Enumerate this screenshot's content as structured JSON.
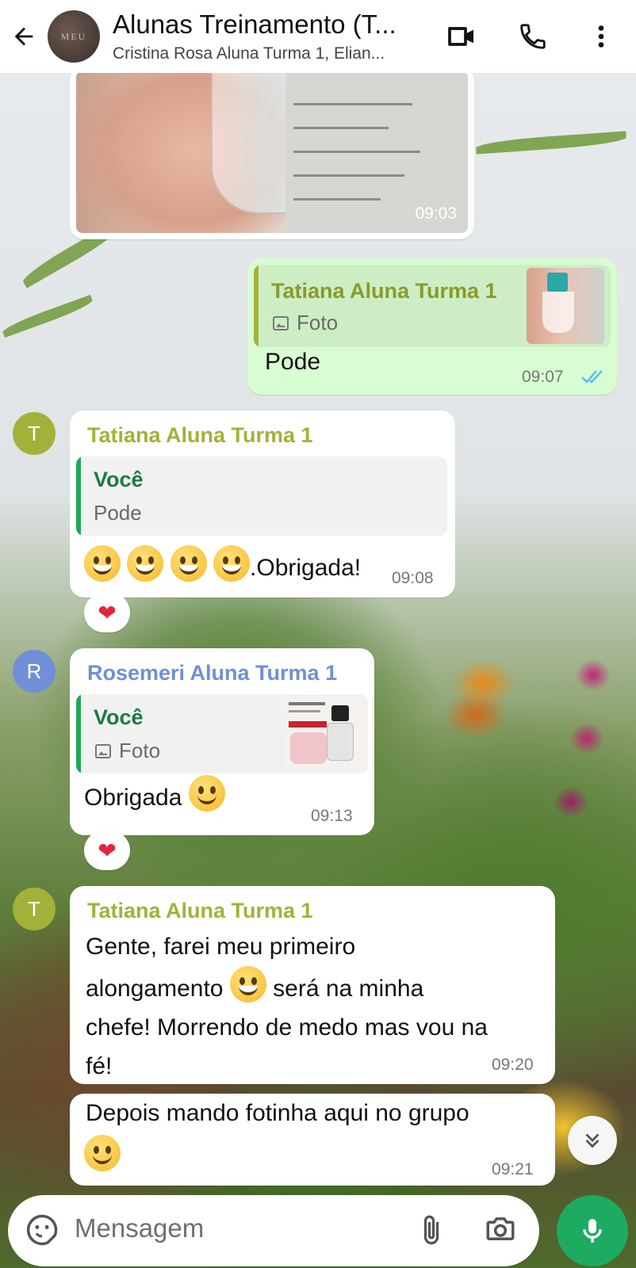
{
  "header": {
    "title": "Alunas Treinamento (T...",
    "subtitle": "Cristina Rosa Aluna Turma 1, Elian...",
    "avatar_text": "MEU"
  },
  "messages": {
    "photo": {
      "time": "09:03"
    },
    "m1": {
      "quote_name": "Tatiana Aluna Turma 1",
      "quote_text": "Foto",
      "text": "Pode",
      "time": "09:07"
    },
    "m2": {
      "avatar_letter": "T",
      "sender": "Tatiana Aluna Turma 1",
      "quote_name": "Você",
      "quote_text": "Pode",
      "text": ".Obrigada!",
      "time": "09:08",
      "reaction": "❤"
    },
    "m3": {
      "avatar_letter": "R",
      "sender": "Rosemeri Aluna Turma 1",
      "quote_name": "Você",
      "quote_text": "Foto",
      "text": "Obrigada",
      "time": "09:13",
      "reaction": "❤"
    },
    "m4": {
      "avatar_letter": "T",
      "sender": "Tatiana Aluna Turma 1",
      "line1": "Gente, farei meu primeiro",
      "line2a": "alongamento",
      "line2b": "será na minha",
      "line3": "chefe! Morrendo de medo mas vou na",
      "line4": "fé!",
      "time": "09:20"
    },
    "m5": {
      "text": "Depois mando fotinha aqui no grupo",
      "time": "09:21"
    }
  },
  "composer": {
    "placeholder": "Mensagem"
  },
  "colors": {
    "accent_green": "#1dab61",
    "tatiana_name": "#a3b138",
    "rosemeri_name": "#6f8fd8",
    "voce_name": "#1b7a43",
    "read_ticks": "#53bdeb"
  },
  "icons": [
    "back-arrow-icon",
    "video-call-icon",
    "phone-icon",
    "more-vert-icon",
    "image-icon",
    "sticker-icon",
    "attach-icon",
    "camera-icon",
    "mic-icon",
    "chevron-double-down-icon",
    "double-check-icon",
    "heart-icon"
  ]
}
